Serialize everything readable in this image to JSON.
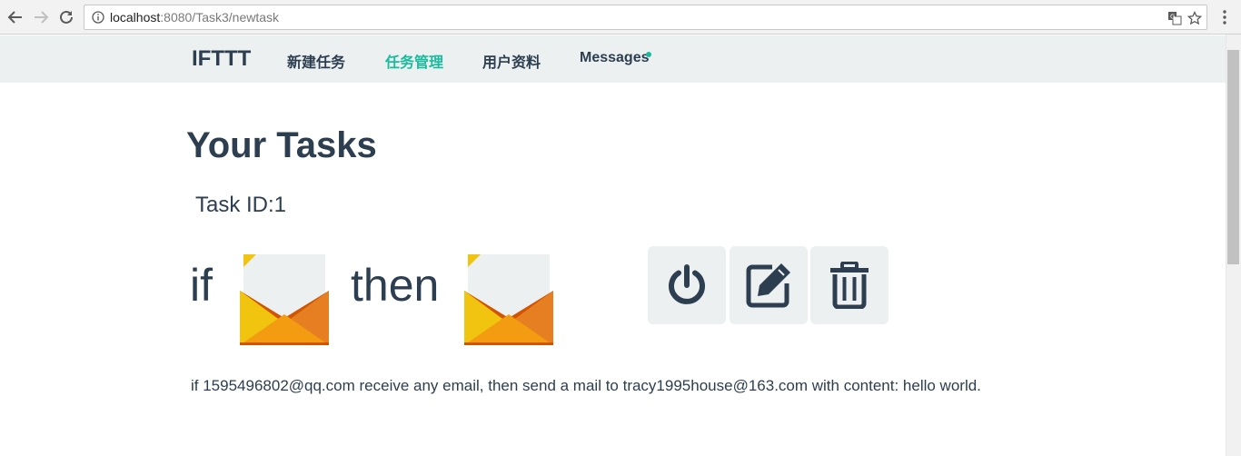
{
  "browser": {
    "url_host": "localhost",
    "url_path": ":8080/Task3/newtask"
  },
  "navbar": {
    "brand": "IFTTT",
    "links": [
      {
        "label": "新建任务",
        "active": false
      },
      {
        "label": "任务管理",
        "active": true
      },
      {
        "label": "用户资料",
        "active": false
      },
      {
        "label": "Messages",
        "active": false
      }
    ],
    "accent_color": "#18bc9c"
  },
  "main": {
    "title": "Your Tasks",
    "task": {
      "id_label": "Task ID:1",
      "if_word": "if",
      "then_word": "then",
      "trigger_icon": "mail-envelope-icon",
      "action_icon": "mail-envelope-icon",
      "buttons": [
        {
          "name": "power-button",
          "icon": "power-icon"
        },
        {
          "name": "edit-button",
          "icon": "edit-icon"
        },
        {
          "name": "delete-button",
          "icon": "trash-icon"
        }
      ],
      "description": "if 1595496802@qq.com receive any email, then send a mail to tracy1995house@163.com with content: hello world."
    }
  },
  "colors": {
    "text": "#2c3e50",
    "nav_bg": "#ecf0f1",
    "envelope_yellow": "#f1c40f",
    "envelope_orange": "#e67e22"
  }
}
